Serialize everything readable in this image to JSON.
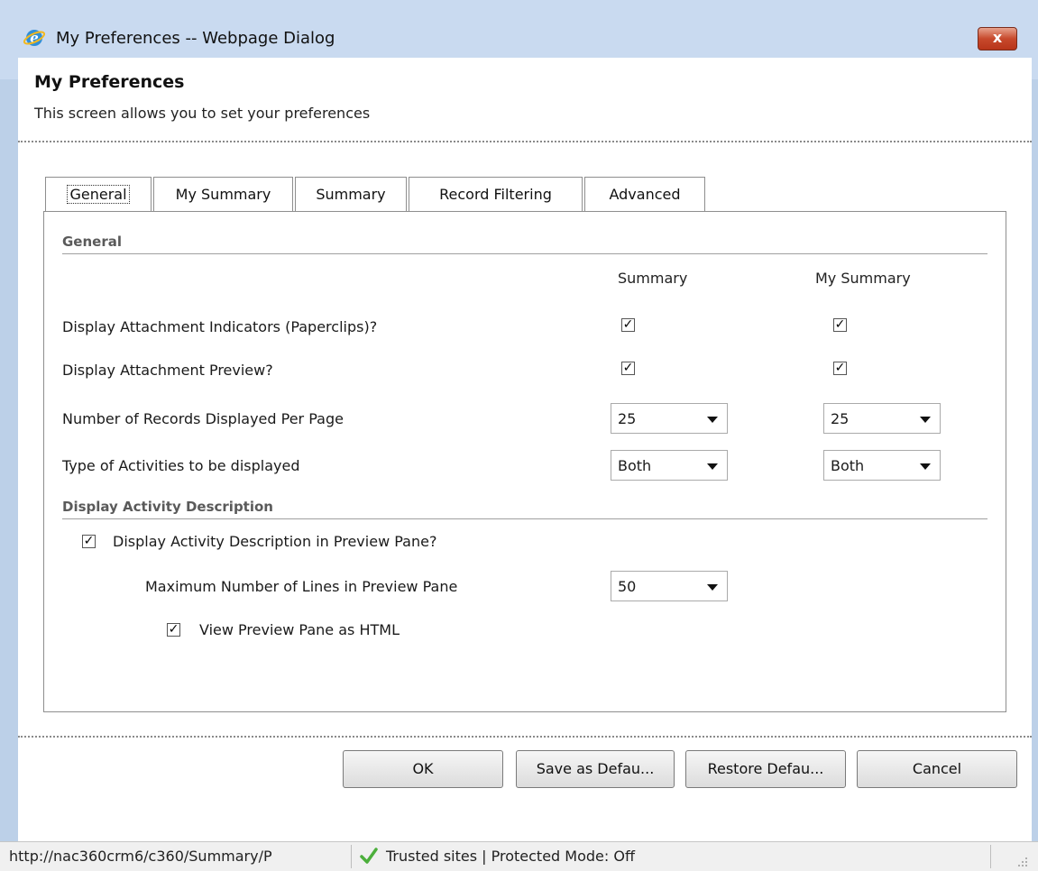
{
  "window": {
    "title": "My Preferences -- Webpage Dialog",
    "close_label": "x"
  },
  "header": {
    "title": "My Preferences",
    "description": "This screen allows you to set your preferences"
  },
  "tabs": [
    {
      "label": "General",
      "active": true
    },
    {
      "label": "My Summary",
      "active": false
    },
    {
      "label": "Summary",
      "active": false
    },
    {
      "label": "Record Filtering",
      "active": false
    },
    {
      "label": "Advanced",
      "active": false
    }
  ],
  "general": {
    "section_title": "General",
    "col_summary": "Summary",
    "col_my_summary": "My Summary",
    "rows": {
      "attachment_indicators": {
        "label": "Display Attachment Indicators (Paperclips)?",
        "summary": true,
        "my_summary": true
      },
      "attachment_preview": {
        "label": "Display Attachment Preview?",
        "summary": true,
        "my_summary": true
      },
      "records_per_page": {
        "label": "Number of Records Displayed Per Page",
        "summary": "25",
        "my_summary": "25"
      },
      "activity_type": {
        "label": "Type of Activities to be displayed",
        "summary": "Both",
        "my_summary": "Both"
      }
    }
  },
  "activity_description": {
    "section_title": "Display Activity Description",
    "show_in_preview": {
      "label": "Display Activity Description in Preview Pane?",
      "checked": true
    },
    "max_lines": {
      "label": "Maximum Number of Lines in Preview Pane",
      "value": "50"
    },
    "view_as_html": {
      "label": "View Preview Pane as HTML",
      "checked": true
    }
  },
  "buttons": {
    "ok": "OK",
    "save_default": "Save as Defau...",
    "restore_default": "Restore Defau...",
    "cancel": "Cancel"
  },
  "statusbar": {
    "url": "http://nac360crm6/c360/Summary/P",
    "zone": "Trusted sites | Protected Mode: Off"
  },
  "colors": {
    "title_bg": "#c9daf0",
    "close_red": "#c7492c",
    "section_grey": "#5a5a5a",
    "check_green": "#4caf3c"
  }
}
